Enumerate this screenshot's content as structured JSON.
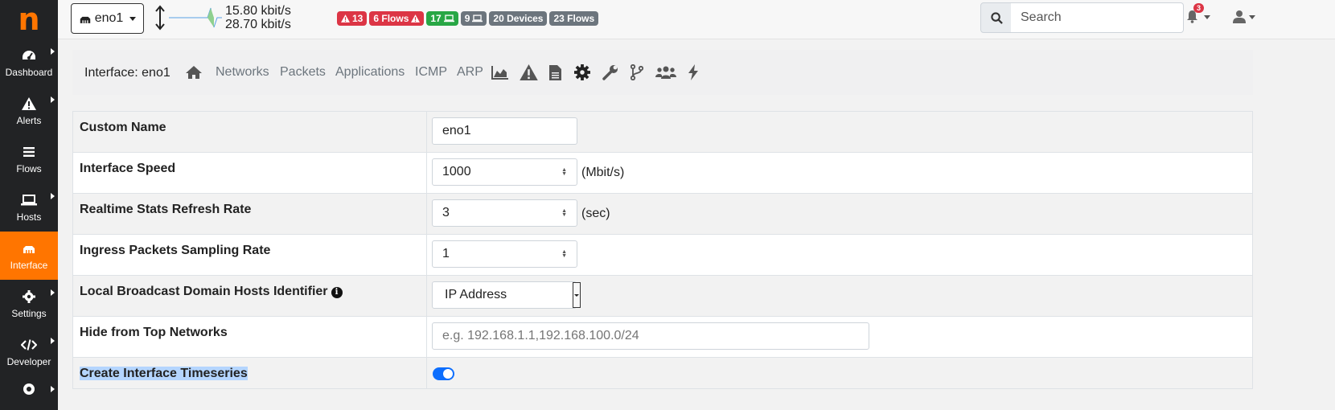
{
  "sidebar": {
    "logo": "n",
    "items": [
      {
        "label": "Dashboard",
        "icon": "gauge-icon"
      },
      {
        "label": "Alerts",
        "icon": "warning-icon"
      },
      {
        "label": "Flows",
        "icon": "bars-icon"
      },
      {
        "label": "Hosts",
        "icon": "laptop-icon"
      },
      {
        "label": "Interface",
        "icon": "ethernet-icon"
      },
      {
        "label": "Settings",
        "icon": "gear-icon"
      },
      {
        "label": "Developer",
        "icon": "code-icon"
      }
    ],
    "active_color": "#ff7500"
  },
  "topbar": {
    "interface": "eno1",
    "rate_up": "15.80 kbit/s",
    "rate_down": "28.70 kbit/s",
    "badges": [
      {
        "text": "13",
        "color": "red",
        "icon": "warning-icon"
      },
      {
        "text": "6 Flows",
        "color": "red",
        "icon": "warning-icon"
      },
      {
        "text": "17",
        "color": "green",
        "icon": "laptop-icon"
      },
      {
        "text": "9",
        "color": "gray",
        "icon": "laptop-icon"
      },
      {
        "text": "20 Devices",
        "color": "gray"
      },
      {
        "text": "23 Flows",
        "color": "gray"
      }
    ],
    "search_placeholder": "Search",
    "notifications": "3"
  },
  "nav": {
    "title": "Interface: eno1",
    "links": [
      "Networks",
      "Packets",
      "Applications",
      "ICMP",
      "ARP"
    ]
  },
  "form": {
    "rows": [
      {
        "label": "Custom Name",
        "value": "eno1"
      },
      {
        "label": "Interface Speed",
        "value": "1000",
        "unit": "(Mbit/s)"
      },
      {
        "label": "Realtime Stats Refresh Rate",
        "value": "3",
        "unit": "(sec)"
      },
      {
        "label": "Ingress Packets Sampling Rate",
        "value": "1"
      },
      {
        "label": "Local Broadcast Domain Hosts Identifier",
        "value": "IP Address"
      },
      {
        "label": "Hide from Top Networks",
        "placeholder": "e.g. 192.168.1.1,192.168.100.0/24"
      },
      {
        "label": "Create Interface Timeseries",
        "enabled": true
      }
    ]
  }
}
